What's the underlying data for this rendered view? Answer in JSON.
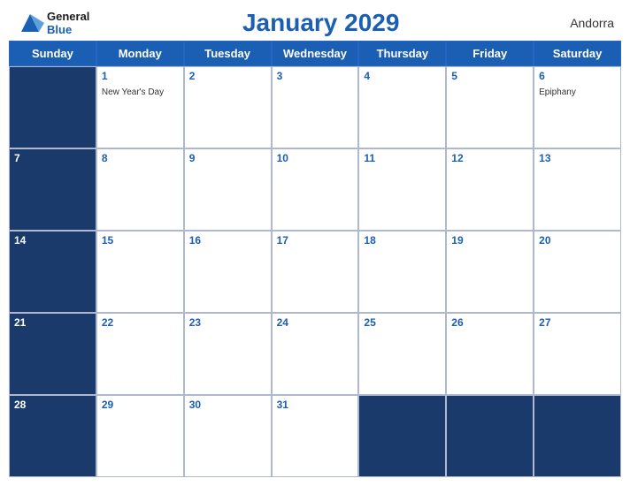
{
  "header": {
    "logo_general": "General",
    "logo_blue": "Blue",
    "title": "January 2029",
    "country": "Andorra"
  },
  "days": [
    "Sunday",
    "Monday",
    "Tuesday",
    "Wednesday",
    "Thursday",
    "Friday",
    "Saturday"
  ],
  "weeks": [
    [
      {
        "date": "",
        "event": "",
        "dark": true
      },
      {
        "date": "1",
        "event": "New Year's Day",
        "dark": false
      },
      {
        "date": "2",
        "event": "",
        "dark": false
      },
      {
        "date": "3",
        "event": "",
        "dark": false
      },
      {
        "date": "4",
        "event": "",
        "dark": false
      },
      {
        "date": "5",
        "event": "",
        "dark": false
      },
      {
        "date": "6",
        "event": "Epiphany",
        "dark": false
      }
    ],
    [
      {
        "date": "7",
        "event": "",
        "dark": true
      },
      {
        "date": "8",
        "event": "",
        "dark": false
      },
      {
        "date": "9",
        "event": "",
        "dark": false
      },
      {
        "date": "10",
        "event": "",
        "dark": false
      },
      {
        "date": "11",
        "event": "",
        "dark": false
      },
      {
        "date": "12",
        "event": "",
        "dark": false
      },
      {
        "date": "13",
        "event": "",
        "dark": false
      }
    ],
    [
      {
        "date": "14",
        "event": "",
        "dark": true
      },
      {
        "date": "15",
        "event": "",
        "dark": false
      },
      {
        "date": "16",
        "event": "",
        "dark": false
      },
      {
        "date": "17",
        "event": "",
        "dark": false
      },
      {
        "date": "18",
        "event": "",
        "dark": false
      },
      {
        "date": "19",
        "event": "",
        "dark": false
      },
      {
        "date": "20",
        "event": "",
        "dark": false
      }
    ],
    [
      {
        "date": "21",
        "event": "",
        "dark": true
      },
      {
        "date": "22",
        "event": "",
        "dark": false
      },
      {
        "date": "23",
        "event": "",
        "dark": false
      },
      {
        "date": "24",
        "event": "",
        "dark": false
      },
      {
        "date": "25",
        "event": "",
        "dark": false
      },
      {
        "date": "26",
        "event": "",
        "dark": false
      },
      {
        "date": "27",
        "event": "",
        "dark": false
      }
    ],
    [
      {
        "date": "28",
        "event": "",
        "dark": true
      },
      {
        "date": "29",
        "event": "",
        "dark": false
      },
      {
        "date": "30",
        "event": "",
        "dark": false
      },
      {
        "date": "31",
        "event": "",
        "dark": false
      },
      {
        "date": "",
        "event": "",
        "dark": true
      },
      {
        "date": "",
        "event": "",
        "dark": true
      },
      {
        "date": "",
        "event": "",
        "dark": true
      }
    ]
  ]
}
